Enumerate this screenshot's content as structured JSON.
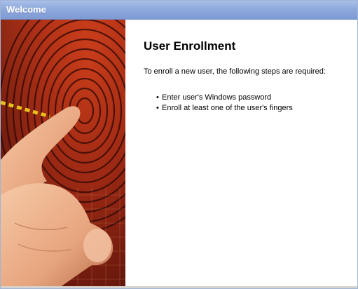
{
  "window": {
    "title": "Welcome"
  },
  "main": {
    "heading": "User Enrollment",
    "intro": "To enroll a new user, the following steps are required:",
    "steps": [
      "Enter user's Windows password",
      "Enroll at least one of the user's fingers"
    ]
  },
  "icons": {
    "bullet": "•"
  },
  "colors": {
    "titlebar": "#8fa9dc",
    "title_text": "#ffffff",
    "art_red": "#a32a14"
  }
}
